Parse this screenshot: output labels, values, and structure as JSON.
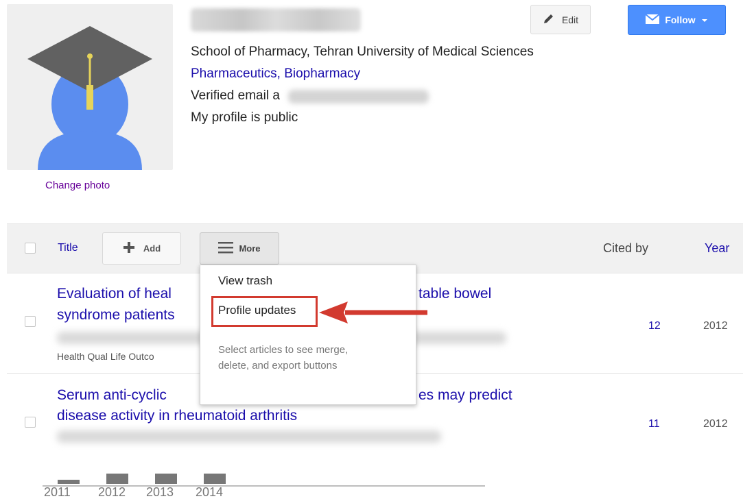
{
  "profile": {
    "change_photo": "Change photo",
    "affiliation": "School of Pharmacy, Tehran University of Medical Sciences",
    "interests": "Pharmaceutics, Biopharmacy",
    "email_prefix": "Verified email a",
    "visibility": "My profile is public"
  },
  "actions": {
    "edit_label": "Edit",
    "follow_label": "Follow"
  },
  "toolbar": {
    "title_label": "Title",
    "add_label": "Add",
    "more_label": "More",
    "cited_by_label": "Cited by",
    "year_label": "Year"
  },
  "menu": {
    "view_trash": "View trash",
    "profile_updates": "Profile updates",
    "hint": "Select articles to see merge, delete, and export buttons"
  },
  "articles": [
    {
      "title_line1": "Evaluation of heal",
      "title_line1_tail": "table bowel",
      "title_line2": "syndrome patients",
      "journal": "Health Qual Life Outco",
      "cited_by": "12",
      "year": "2012"
    },
    {
      "title_line1": "Serum anti-cyclic",
      "title_line1_tail": "es may predict",
      "title_line2": "disease activity in rheumatoid arthritis",
      "cited_by": "11",
      "year": "2012"
    }
  ],
  "histogram": {
    "years": [
      "2011",
      "2012",
      "2013",
      "2014"
    ],
    "relative_heights": [
      0.4,
      1.0,
      1.0,
      1.0
    ]
  },
  "colors": {
    "link": "#1a0dab",
    "visited": "#660099",
    "follow_button": "#4d90fe",
    "highlight": "#d23a2f"
  }
}
